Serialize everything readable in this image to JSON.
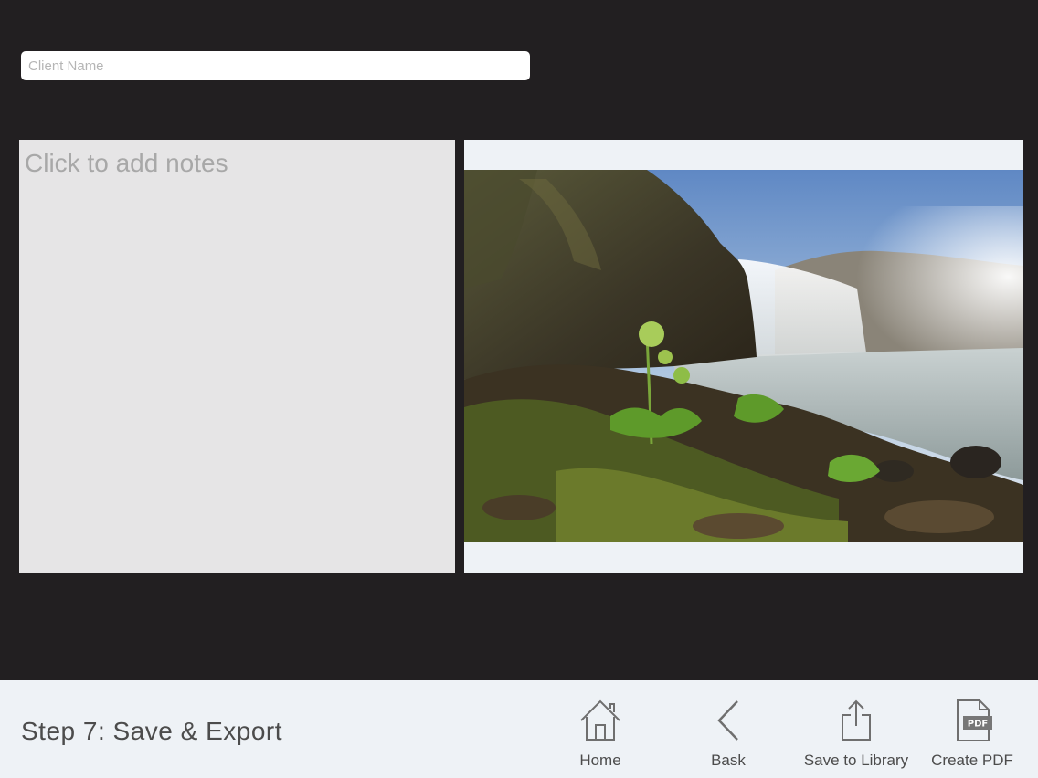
{
  "client": {
    "placeholder": "Client Name",
    "value": ""
  },
  "notes": {
    "placeholder": "Click to add notes",
    "value": ""
  },
  "photo": {
    "description": "waterfall landscape photograph"
  },
  "toolbar": {
    "step_title": "Step 7: Save & Export",
    "home_label": "Home",
    "back_label": "Bask",
    "save_label": "Save to Library",
    "pdf_label": "Create PDF",
    "pdf_icon_text": "PDF"
  },
  "colors": {
    "background": "#221f21",
    "panel": "#e6e5e6",
    "bar": "#eef2f6",
    "text": "#4c4c4c",
    "icon": "#6f6f6f"
  },
  "icons": {
    "home": "home-icon",
    "back": "chevron-left-icon",
    "save": "share-upload-icon",
    "pdf": "pdf-document-icon"
  }
}
